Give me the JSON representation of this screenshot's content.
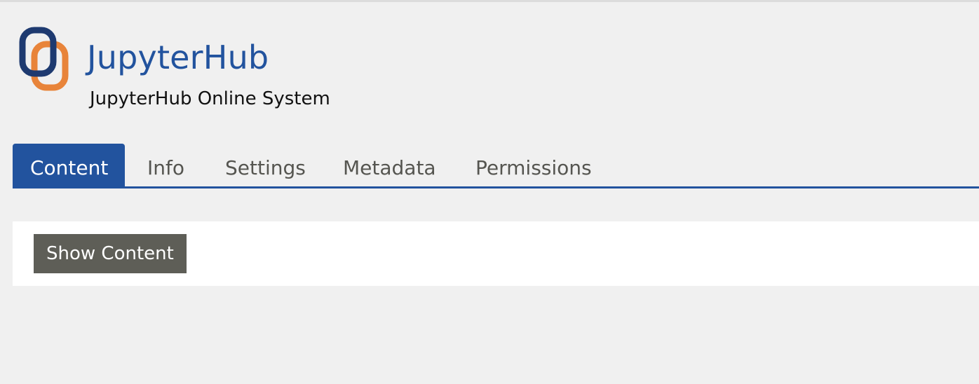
{
  "header": {
    "title": "JupyterHub",
    "subtitle": "JupyterHub Online System",
    "logo_icon": "jupyterhub-logo-icon"
  },
  "tabs": [
    {
      "label": "Content",
      "active": true
    },
    {
      "label": "Info",
      "active": false
    },
    {
      "label": "Settings",
      "active": false
    },
    {
      "label": "Metadata",
      "active": false
    },
    {
      "label": "Permissions",
      "active": false
    }
  ],
  "panel": {
    "button_label": "Show Content"
  },
  "colors": {
    "brand_blue": "#22539e",
    "logo_orange": "#e8843a",
    "logo_navy": "#1e3a70",
    "background": "#f0f0f0",
    "button_gray": "#5e5e57"
  }
}
